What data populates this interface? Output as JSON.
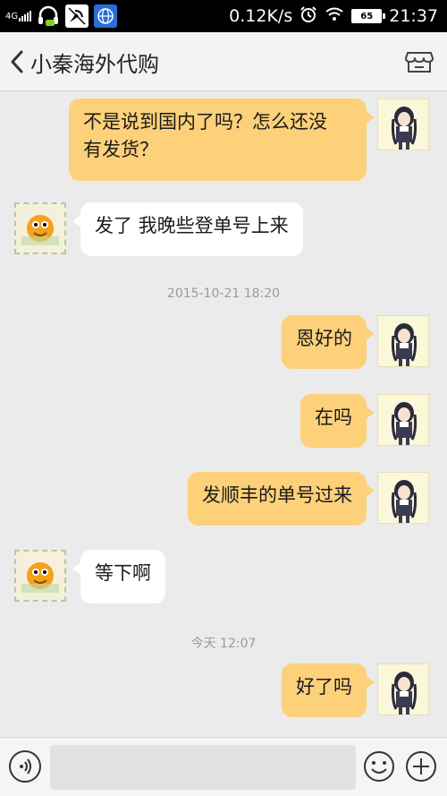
{
  "status_bar": {
    "network": "4G",
    "speed": "0.12K/s",
    "battery": "65",
    "time": "21:37"
  },
  "header": {
    "title": "小秦海外代购"
  },
  "messages": [
    {
      "side": "me",
      "text_line1": "不是说到国内了吗？怎么还没",
      "text_line2": "有发货？"
    },
    {
      "side": "them",
      "text": "发了 我晚些登单号上来"
    },
    {
      "type": "timestamp",
      "text": "2015-10-21 18:20"
    },
    {
      "side": "me",
      "text": "恩好的"
    },
    {
      "side": "me",
      "text": "在吗"
    },
    {
      "side": "me",
      "text": "发顺丰的单号过来"
    },
    {
      "side": "them",
      "text": "等下啊"
    },
    {
      "type": "timestamp",
      "text": "今天 12:07"
    },
    {
      "side": "me",
      "text": "好了吗"
    }
  ],
  "input": {
    "value": ""
  },
  "colors": {
    "my_bubble": "#fdd07a",
    "their_bubble": "#ffffff",
    "background": "#ebebeb"
  }
}
